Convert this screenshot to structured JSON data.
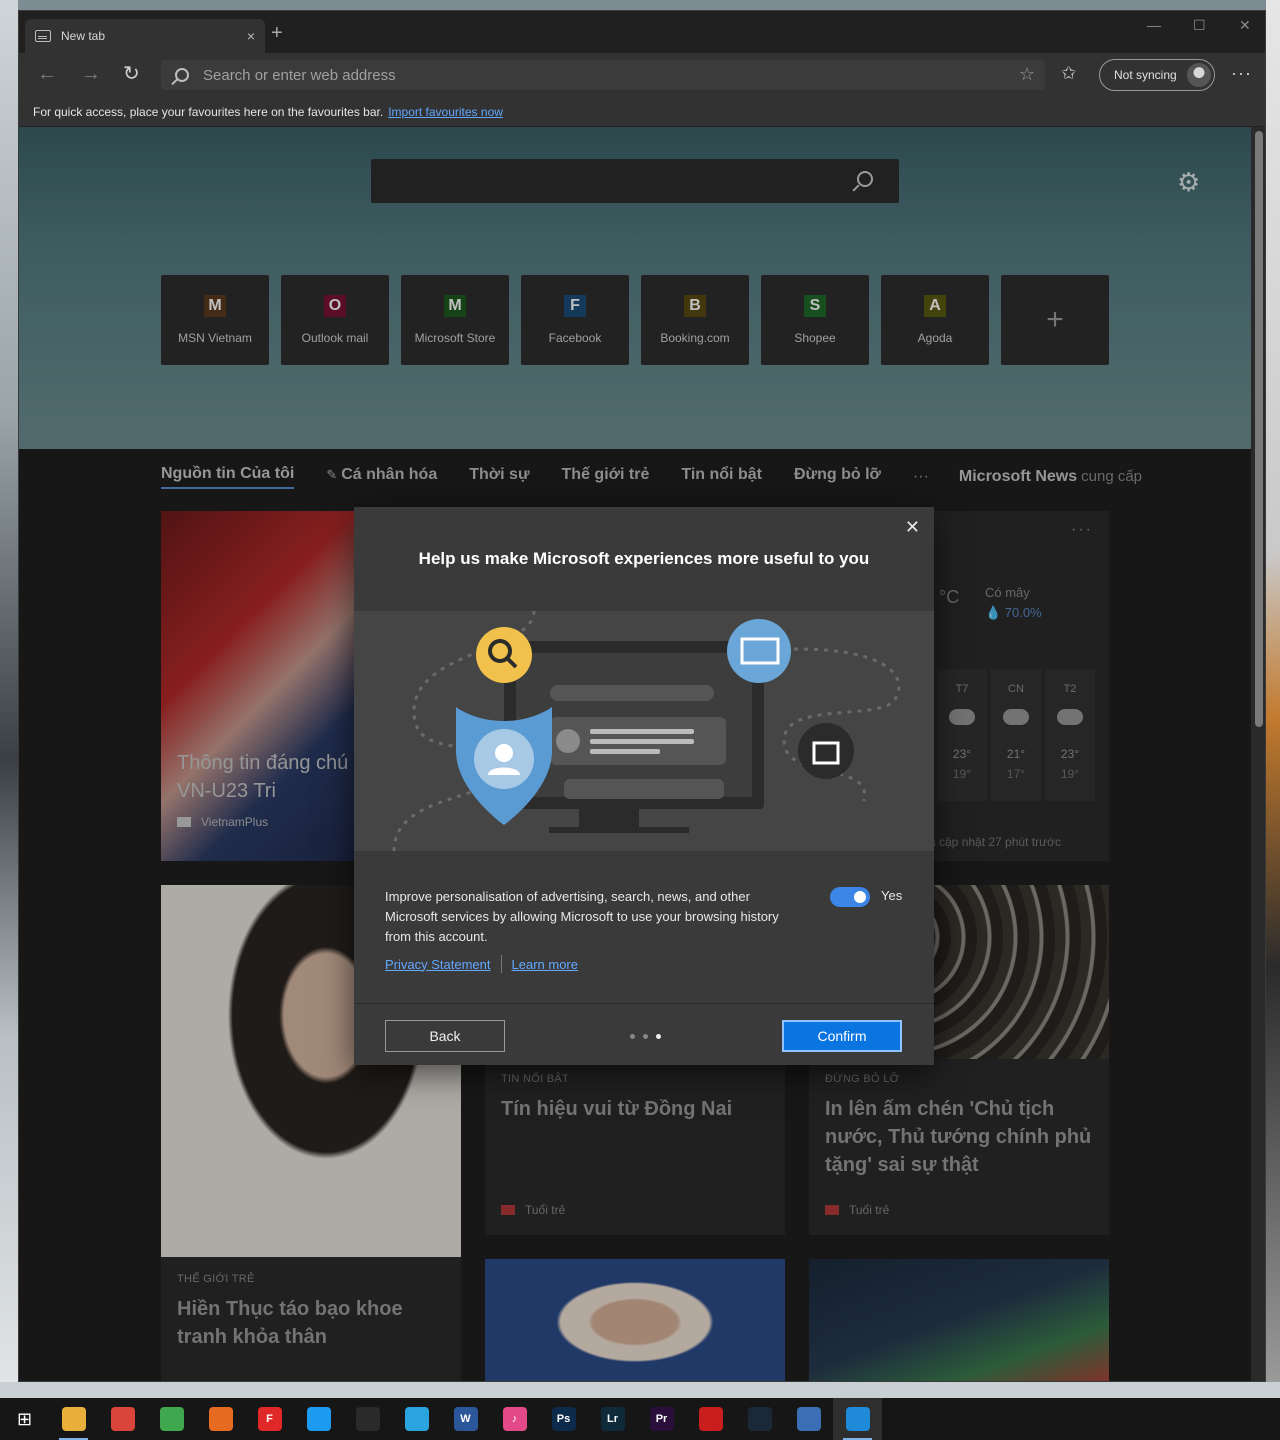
{
  "browser": {
    "tab_title": "New tab",
    "tab_close": "×",
    "new_tab": "+",
    "minimize": "—",
    "maximize": "☐",
    "close": "✕",
    "back": "←",
    "forward": "→",
    "refresh": "↻",
    "address_placeholder": "Search or enter web address",
    "fav_star": "☆",
    "favorites_icon": "✩",
    "sync_label": "Not syncing",
    "more": "···"
  },
  "favbar": {
    "text": "For quick access, place your favourites here on the favourites bar.",
    "link": "Import favourites now"
  },
  "newtab": {
    "gear": "⚙",
    "tiles": [
      {
        "letter": "M",
        "label": "MSN Vietnam",
        "color": "#5a3a1e"
      },
      {
        "letter": "O",
        "label": "Outlook mail",
        "color": "#7a1133"
      },
      {
        "letter": "M",
        "label": "Microsoft Store",
        "color": "#1c5a1c"
      },
      {
        "letter": "F",
        "label": "Facebook",
        "color": "#1a4d7a"
      },
      {
        "letter": "B",
        "label": "Booking.com",
        "color": "#5a4a12"
      },
      {
        "letter": "S",
        "label": "Shopee",
        "color": "#1f6a2a"
      },
      {
        "letter": "A",
        "label": "Agoda",
        "color": "#5a5a12"
      }
    ],
    "add_tile": "+"
  },
  "news_nav": {
    "items": [
      "Nguồn tin Của tôi",
      "Cá nhân hóa",
      "Thời sự",
      "Thế giới trẻ",
      "Tin nổi bật",
      "Đừng bỏ lỡ"
    ],
    "pencil": "✎",
    "dots": "···",
    "provider": "Microsoft News",
    "provider_suffix": "cung cấp"
  },
  "cards": {
    "football": {
      "headline": "Thông tin đáng chú trận U23 VN-U23 Tri",
      "source": "VietnamPlus"
    },
    "portrait": {
      "kicker": "THẾ GIỚI TRẺ",
      "headline": "Hiền Thục táo bạo khoe tranh khỏa thân"
    },
    "dongnai": {
      "kicker": "TIN NỔI BẬT",
      "headline": "Tín hiệu vui từ Đồng Nai",
      "source": "Tuổi trẻ"
    },
    "cups": {
      "kicker": "ĐỪNG BỎ LỠ",
      "headline": "In lên ấm chén 'Chủ tịch nước, Thủ tướng chính phủ tặng' sai sự thật",
      "source": "Tuổi trẻ"
    }
  },
  "weather": {
    "more": "···",
    "unit": "°C",
    "condition": "Có mây",
    "humidity": "💧 70.0%",
    "forecast": [
      {
        "day": "T7",
        "hi": "23°",
        "lo": "19°"
      },
      {
        "day": "CN",
        "hi": "21°",
        "lo": "17°"
      },
      {
        "day": "T2",
        "hi": "23°",
        "lo": "19°"
      }
    ],
    "updated": "ã cập nhật 27 phút trước"
  },
  "dialog": {
    "close": "✕",
    "title": "Help us make Microsoft experiences more useful to you",
    "body": "Improve personalisation of advertising, search, news, and other Microsoft services by allowing Microsoft to use your browsing history from this account.",
    "toggle_label": "Yes",
    "toggle_on": true,
    "privacy_link": "Privacy Statement",
    "learn_link": "Learn more",
    "back": "Back",
    "confirm": "Confirm"
  },
  "taskbar": {
    "icons": [
      {
        "name": "windows-start-icon",
        "glyph": "⊞",
        "color": "#161616"
      },
      {
        "name": "file-explorer-icon",
        "glyph": "",
        "color": "#e8b03a"
      },
      {
        "name": "chrome-icon",
        "glyph": "",
        "color": "#d9453a"
      },
      {
        "name": "tick-tick-icon",
        "glyph": "",
        "color": "#3fa84f"
      },
      {
        "name": "firefox-icon",
        "glyph": "",
        "color": "#e66a1f"
      },
      {
        "name": "flipboard-icon",
        "glyph": "F",
        "color": "#e12828"
      },
      {
        "name": "twitter-icon",
        "glyph": "",
        "color": "#1d9bf0"
      },
      {
        "name": "photos-icon",
        "glyph": "",
        "color": "#2a2a2a"
      },
      {
        "name": "telegram-icon",
        "glyph": "",
        "color": "#2aa3de"
      },
      {
        "name": "word-icon",
        "glyph": "W",
        "color": "#2b579a"
      },
      {
        "name": "itunes-icon",
        "glyph": "♪",
        "color": "#e44a8a"
      },
      {
        "name": "photoshop-icon",
        "glyph": "Ps",
        "color": "#0c2a4a"
      },
      {
        "name": "lightroom-icon",
        "glyph": "Lr",
        "color": "#0f2a3a"
      },
      {
        "name": "premiere-icon",
        "glyph": "Pr",
        "color": "#2a0f3a"
      },
      {
        "name": "acrobat-icon",
        "glyph": "",
        "color": "#c81e1e"
      },
      {
        "name": "steam-icon",
        "glyph": "",
        "color": "#1b2838"
      },
      {
        "name": "support-icon",
        "glyph": "",
        "color": "#3a6fb5"
      },
      {
        "name": "edge-icon",
        "glyph": "",
        "color": "#1e8ad8"
      }
    ]
  }
}
